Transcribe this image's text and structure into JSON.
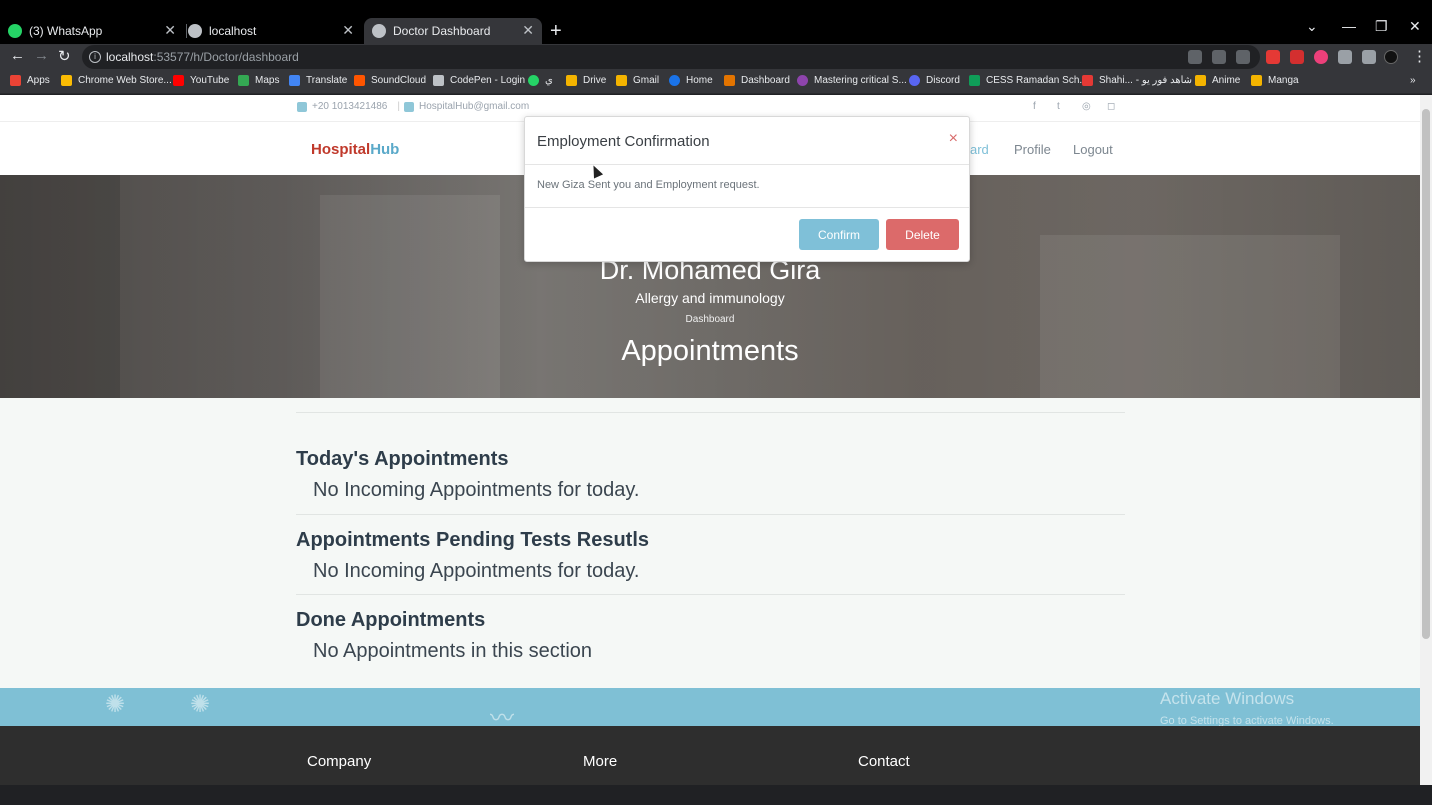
{
  "browser": {
    "tabs": [
      {
        "label": "(3) WhatsApp",
        "icon": "whatsapp-icon",
        "color": "#25d366"
      },
      {
        "label": "localhost",
        "icon": "globe-icon",
        "color": "#bdc1c6"
      },
      {
        "label": "Doctor Dashboard",
        "icon": "globe-icon",
        "color": "#bdc1c6"
      }
    ],
    "url_host": "localhost",
    "url_path": ":53577/h/Doctor/dashboard",
    "bookmarks": [
      {
        "label": "Apps",
        "color": "#ea4335"
      },
      {
        "label": "Chrome Web Store...",
        "color": "#fbbc04"
      },
      {
        "label": "YouTube",
        "color": "#ff0000"
      },
      {
        "label": "Maps",
        "color": "#34a853"
      },
      {
        "label": "Translate",
        "color": "#4285f4"
      },
      {
        "label": "SoundCloud",
        "color": "#ff5500"
      },
      {
        "label": "CodePen - Login",
        "color": "#bdc1c6"
      },
      {
        "label": "ي",
        "color": "#25d366"
      },
      {
        "label": "Drive",
        "color": "#f4b400"
      },
      {
        "label": "Gmail",
        "color": "#f4b400"
      },
      {
        "label": "Home",
        "color": "#1a73e8"
      },
      {
        "label": "Dashboard",
        "color": "#e37400"
      },
      {
        "label": "Mastering critical S...",
        "color": "#8e44ad"
      },
      {
        "label": "Discord",
        "color": "#5865f2"
      },
      {
        "label": "CESS Ramadan Sch...",
        "color": "#0f9d58"
      },
      {
        "label": "Shahi... - شاهد فور يو",
        "color": "#e53935"
      },
      {
        "label": "Anime",
        "color": "#f4b400"
      },
      {
        "label": "Manga",
        "color": "#f4b400"
      }
    ]
  },
  "site": {
    "phone": "+20 1013421486",
    "email": "HospitalHub@gmail.com",
    "logo_part1": "Hospital",
    "logo_part2": "Hub",
    "nav": {
      "dashboard": "ard",
      "profile": "Profile",
      "logout": "Logout"
    },
    "doctor_name": "Dr. Mohamed Gira",
    "specialty": "Allergy and immunology",
    "breadcrumb": "Dashboard",
    "section_title": "Appointments"
  },
  "sections": [
    {
      "heading": "Today's Appointments",
      "text": "No Incoming Appointments for today."
    },
    {
      "heading": "Appointments Pending Tests Resutls",
      "text": "No Incoming Appointments for today."
    },
    {
      "heading": "Done Appointments",
      "text": "No Appointments in this section"
    }
  ],
  "footer": {
    "company": "Company",
    "more": "More",
    "contact": "Contact"
  },
  "modal": {
    "title": "Employment Confirmation",
    "body": "New Giza Sent you and Employment request.",
    "confirm": "Confirm",
    "delete": "Delete",
    "close": "×"
  },
  "watermark": {
    "line1": "Activate Windows",
    "line2": "Go to Settings to activate Windows."
  }
}
